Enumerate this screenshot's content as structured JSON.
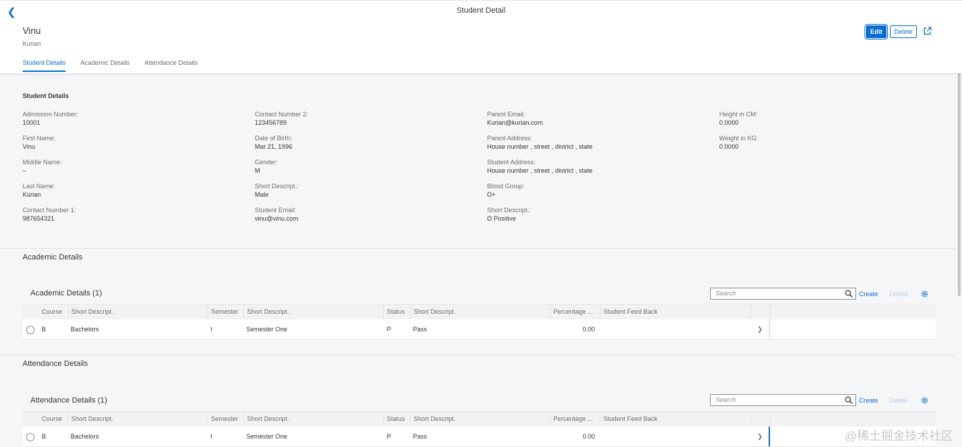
{
  "header": {
    "back_icon": "chevron-left-icon",
    "title": "Student Detail",
    "heading": "Vinu",
    "subheading": "Kurian",
    "edit_label": "Edit",
    "delete_label": "Delete",
    "share_icon": "share-icon"
  },
  "tabs": [
    "Student Details",
    "Academic Details",
    "Attendance Details"
  ],
  "student_details": {
    "title": "Student Details",
    "columns": [
      [
        {
          "label": "Admission Number:",
          "value": "10001"
        },
        {
          "label": "First Name:",
          "value": "Vinu"
        },
        {
          "label": "Middle Name:",
          "value": "–"
        },
        {
          "label": "Last Name:",
          "value": "Kurian"
        },
        {
          "label": "Contact Number 1:",
          "value": "987654321"
        }
      ],
      [
        {
          "label": "Contact Number 2:",
          "value": "123456789"
        },
        {
          "label": "Date of Birth:",
          "value": "Mar 21, 1996"
        },
        {
          "label": "Gender:",
          "value": "M"
        },
        {
          "label": "Short Descript.:",
          "value": "Male"
        },
        {
          "label": "Student Email:",
          "value": "vinu@vinu.com"
        }
      ],
      [
        {
          "label": "Parent Email:",
          "value": "Kurian@kurian.com"
        },
        {
          "label": "Parent Address:",
          "value": "House number , street , district , state"
        },
        {
          "label": "Student Address:",
          "value": "House number , street , district , state"
        },
        {
          "label": "Blood Group:",
          "value": "O+"
        },
        {
          "label": "Short Descript.:",
          "value": "O Positive"
        }
      ],
      [
        {
          "label": "Height in CM:",
          "value": "0.0000"
        },
        {
          "label": "Weight in KG:",
          "value": "0.0000"
        }
      ]
    ]
  },
  "academic": {
    "section_title": "Academic Details",
    "table_title": "Academic Details (1)",
    "search_placeholder": "Search",
    "create_label": "Create",
    "delete_label": "Delete",
    "columns": [
      "Course",
      "Short Descript.",
      "Semester",
      "Short Descript.",
      "Status",
      "Short Descript.",
      "Percentage ...",
      "Student Feed Back"
    ],
    "rows": [
      {
        "course": "B",
        "course_desc": "Bachelors",
        "semester": "I",
        "semester_desc": "Semester One",
        "status": "P",
        "status_desc": "Pass",
        "percentage": "0.00",
        "feedback": ""
      }
    ]
  },
  "attendance": {
    "section_title": "Attendance Details",
    "table_title": "Attendance Details (1)",
    "search_placeholder": "Search",
    "create_label": "Create",
    "delete_label": "Delete",
    "columns": [
      "Course",
      "Short Descript.",
      "Semester",
      "Short Descript.",
      "Status",
      "Short Descript.",
      "Percentage ...",
      "Student Feed Back"
    ],
    "rows": [
      {
        "course": "B",
        "course_desc": "Bachelors",
        "semester": "I",
        "semester_desc": "Semester One",
        "status": "P",
        "status_desc": "Pass",
        "percentage": "0.00",
        "feedback": ""
      }
    ]
  },
  "watermark": "@稀土掘金技术社区",
  "colors": {
    "accent": "#0a6ed1",
    "background": "#f5f6f7",
    "text": "#32363a",
    "muted": "#6a6d70"
  }
}
